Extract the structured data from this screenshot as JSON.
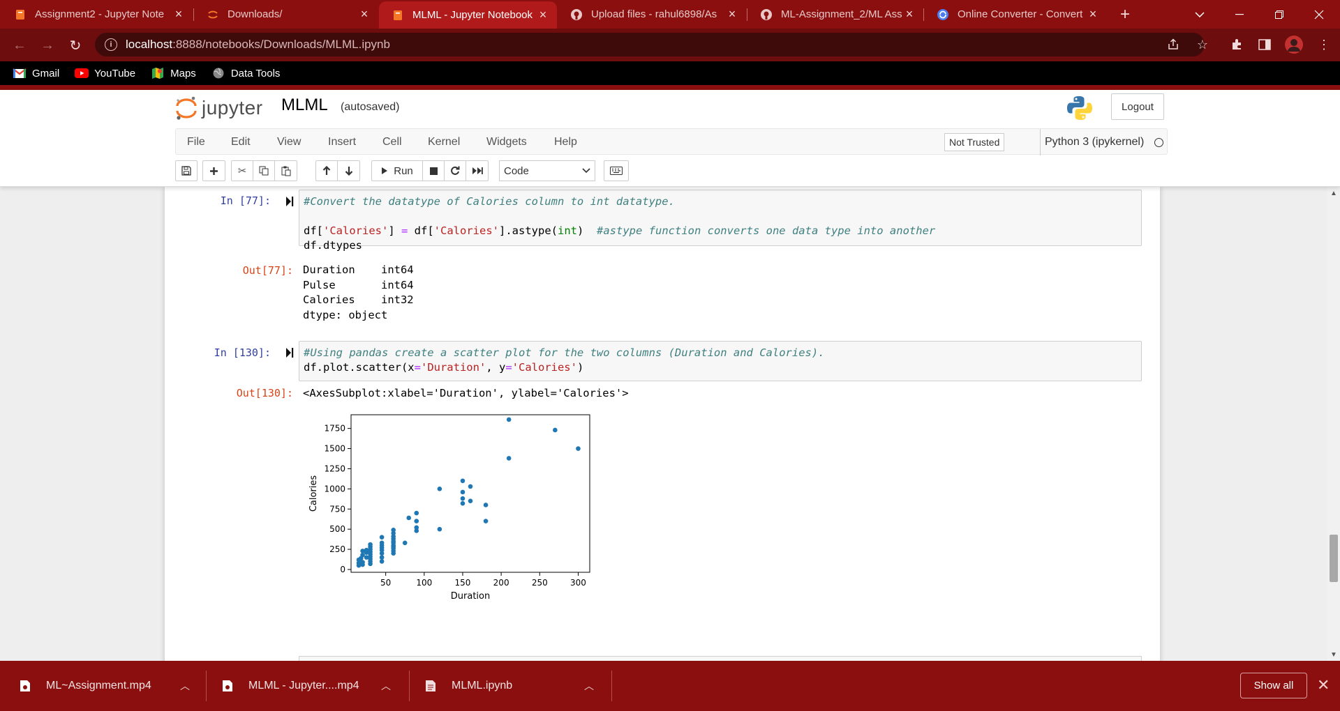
{
  "browser": {
    "tabs": [
      {
        "title": "Assignment2 - Jupyter Note",
        "icon": "jupyter-book-icon",
        "active": false
      },
      {
        "title": "Downloads/",
        "icon": "jupyter-icon",
        "active": false
      },
      {
        "title": "MLML - Jupyter Notebook",
        "icon": "jupyter-book-icon",
        "active": true
      },
      {
        "title": "Upload files - rahul6898/As",
        "icon": "github-icon",
        "active": false
      },
      {
        "title": "ML-Assignment_2/ML Assi",
        "icon": "github-icon",
        "active": false
      },
      {
        "title": "Online Converter - Convert",
        "icon": "converter-icon",
        "active": false
      }
    ],
    "url_host": "localhost",
    "url_rest": ":8888/notebooks/Downloads/MLML.ipynb",
    "bookmarks": [
      {
        "label": "Gmail",
        "icon": "gmail-icon"
      },
      {
        "label": "YouTube",
        "icon": "youtube-icon"
      },
      {
        "label": "Maps",
        "icon": "maps-icon"
      },
      {
        "label": "Data Tools",
        "icon": "globe-icon"
      }
    ]
  },
  "jupyter": {
    "logo_text": "jupyter",
    "notebook_name": "MLML",
    "autosave_status": "(autosaved)",
    "logout_label": "Logout",
    "menu": [
      "File",
      "Edit",
      "View",
      "Insert",
      "Cell",
      "Kernel",
      "Widgets",
      "Help"
    ],
    "trusted_label": "Not Trusted",
    "kernel_label": "Python 3 (ipykernel)",
    "run_label": "Run",
    "cell_type": "Code"
  },
  "cells": [
    {
      "in_prompt": "In [77]:",
      "code_line1": "#Convert the datatype of Calories column to int datatype.",
      "code_line3": {
        "p1": "df[",
        "s1": "'Calories'",
        "p2": "] ",
        "op": "=",
        "p3": " df[",
        "s2": "'Calories'",
        "p4": "].astype(",
        "b1": "int",
        "p5": ")  ",
        "c1": "#astype function converts one data type into another"
      },
      "code_line4": "df.dtypes",
      "out_prompt": "Out[77]:",
      "output": "Duration    int64\nPulse       int64\nCalories    int32\ndtype: object"
    },
    {
      "in_prompt": "In [130]:",
      "code_line1": "#Using pandas create a scatter plot for the two columns (Duration and Calories).",
      "code_line2": {
        "p1": "df.plot.scatter(x",
        "op1": "=",
        "s1": "'Duration'",
        "p2": ", y",
        "op2": "=",
        "s2": "'Calories'",
        "p3": ")"
      },
      "out_prompt": "Out[130]:",
      "output": "<AxesSubplot:xlabel='Duration', ylabel='Calories'>"
    }
  ],
  "chart_data": {
    "type": "scatter",
    "xlabel": "Duration",
    "ylabel": "Calories",
    "xlim": [
      5,
      315
    ],
    "ylim": [
      -35,
      1920
    ],
    "xticks": [
      50,
      100,
      150,
      200,
      250,
      300
    ],
    "yticks": [
      0,
      250,
      500,
      750,
      1000,
      1250,
      1500,
      1750
    ],
    "color": "#1f77b4",
    "points": [
      [
        15,
        50
      ],
      [
        15,
        80
      ],
      [
        15,
        120
      ],
      [
        17,
        100
      ],
      [
        18,
        140
      ],
      [
        20,
        60
      ],
      [
        20,
        90
      ],
      [
        20,
        180
      ],
      [
        20,
        230
      ],
      [
        25,
        150
      ],
      [
        25,
        210
      ],
      [
        25,
        240
      ],
      [
        30,
        70
      ],
      [
        30,
        100
      ],
      [
        30,
        130
      ],
      [
        30,
        160
      ],
      [
        30,
        190
      ],
      [
        30,
        220
      ],
      [
        30,
        250
      ],
      [
        30,
        280
      ],
      [
        30,
        310
      ],
      [
        45,
        100
      ],
      [
        45,
        150
      ],
      [
        45,
        200
      ],
      [
        45,
        240
      ],
      [
        45,
        270
      ],
      [
        45,
        300
      ],
      [
        45,
        330
      ],
      [
        45,
        400
      ],
      [
        60,
        200
      ],
      [
        60,
        230
      ],
      [
        60,
        260
      ],
      [
        60,
        280
      ],
      [
        60,
        300
      ],
      [
        60,
        330
      ],
      [
        60,
        350
      ],
      [
        60,
        380
      ],
      [
        60,
        410
      ],
      [
        60,
        450
      ],
      [
        60,
        490
      ],
      [
        75,
        330
      ],
      [
        80,
        640
      ],
      [
        90,
        480
      ],
      [
        90,
        520
      ],
      [
        90,
        600
      ],
      [
        90,
        700
      ],
      [
        120,
        500
      ],
      [
        120,
        1000
      ],
      [
        150,
        820
      ],
      [
        150,
        880
      ],
      [
        150,
        960
      ],
      [
        150,
        1100
      ],
      [
        160,
        850
      ],
      [
        160,
        1030
      ],
      [
        180,
        600
      ],
      [
        180,
        800
      ],
      [
        210,
        1380
      ],
      [
        210,
        1860
      ],
      [
        270,
        1730
      ],
      [
        300,
        1500
      ]
    ]
  },
  "downloads": {
    "items": [
      {
        "name": "ML~Assignment.mp4",
        "icon": "video-file-icon"
      },
      {
        "name": "MLML - Jupyter....mp4",
        "icon": "video-file-icon"
      },
      {
        "name": "MLML.ipynb",
        "icon": "file-icon"
      }
    ],
    "show_all_label": "Show all"
  }
}
